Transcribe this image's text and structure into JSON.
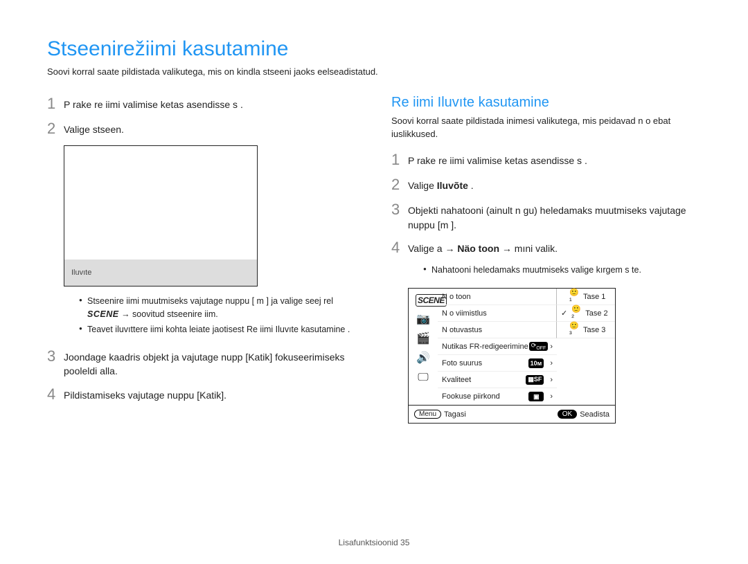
{
  "page": {
    "title": "Stseenirežiimi kasutamine",
    "subtitle": "Soovi korral saate pildistada valikutega, mis on kindla stseeni jaoks eelseadistatud.",
    "footer": "Lisafunktsioonid  35"
  },
  "left": {
    "steps": {
      "1": "P  rake re iimi valimise ketas asendisse   s     .",
      "2": "Valige stseen.",
      "3a": "Joondage kaadris objekt ja vajutage nupp ",
      "3_b": "[Katik]",
      "3c": " fokuseerimiseks pooleldi alla.",
      "4a": "Pildistamiseks vajutage nuppu ",
      "4b": "[Katik]",
      "4c": "."
    },
    "screenshot_label": "Iluvıte",
    "bullets": {
      "b1a": "Stseenire iimi muutmiseks vajutage nuppu [ m       ] ja valige seej rel  ",
      "b1_scene": "SCENE",
      "b1b": "  → soovitud stseenire iim.",
      "b2": "Teavet iluvıttere iimi kohta leiate jaotisest    Re iimi Iluvıte kasutamine ."
    }
  },
  "right": {
    "section_title": "Re iimi Iluvıte kasutamine",
    "section_intro": "Soovi korral saate pildistada inimesi valikutega, mis peidavad n o ebat iuslikkused.",
    "steps": {
      "1": "P  rake re iimi valimise ketas asendisse   s     .",
      "2a": "Valige ",
      "2b": "Iluvõte",
      "2c": " .",
      "3a": "Objekti nahatooni (ainult n gu) heledamaks muutmiseks vajutage nuppu [m       ].",
      "4a": "Valige a    → ",
      "4b": "Näo toon",
      "4c": "  → mıni valik."
    },
    "sub_bullet": "Nahatooni heledamaks muutmiseks valige kırgem s te."
  },
  "camera": {
    "menu": {
      "r1": "N o toon",
      "r2": "N o viimistlus",
      "r3": "N otuvastus",
      "r4": "Nutikas FR-redigeerimine",
      "r5": "Foto suurus",
      "r6": "Kvaliteet",
      "r7": "Fookuse piirkond"
    },
    "options": {
      "o1": "Tase 1",
      "o2": "Tase 2",
      "o3": "Tase 3"
    },
    "footer": {
      "menu_label": "Menu",
      "back": "Tagasi",
      "ok_label": "OK",
      "set": "Seadista"
    }
  }
}
